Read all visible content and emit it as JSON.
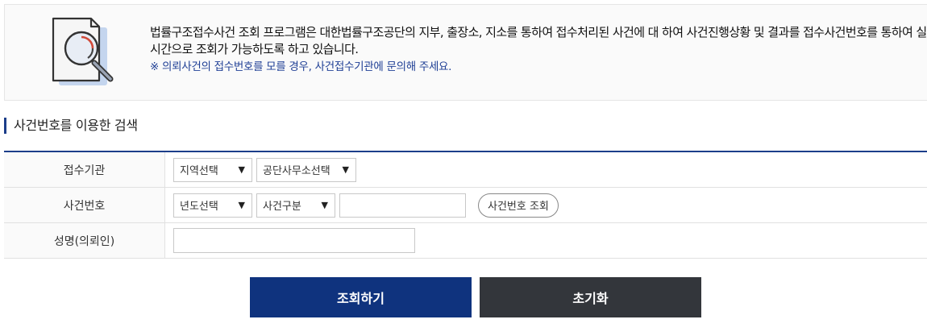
{
  "intro": {
    "description": "법률구조접수사건 조회 프로그램은 대한법률구조공단의 지부, 출장소, 지소를 통하여 접수처리된 사건에 대 하여 사건진행상황 및 결과를 접수사건번호를 통하여 실시간으로 조회가 가능하도록 하고 있습니다.",
    "note": "※ 의뢰사건의 접수번호를 모를 경우, 사건접수기관에 문의해 주세요.",
    "icon": "document-search-icon"
  },
  "section_title": "사건번호를 이용한 검색",
  "form": {
    "agency": {
      "label": "접수기관",
      "region_select": "지역선택",
      "office_select": "공단사무소선택"
    },
    "case_number": {
      "label": "사건번호",
      "year_select": "년도선택",
      "type_select": "사건구분",
      "number_value": "",
      "lookup_button": "사건번호 조회"
    },
    "client_name": {
      "label": "성명(의뢰인)",
      "value": ""
    }
  },
  "buttons": {
    "search": "조회하기",
    "reset": "초기화"
  },
  "colors": {
    "accent": "#1c3e8a",
    "search_button": "#0f337e",
    "reset_button": "#33363b",
    "note_text": "#1f3f95"
  }
}
